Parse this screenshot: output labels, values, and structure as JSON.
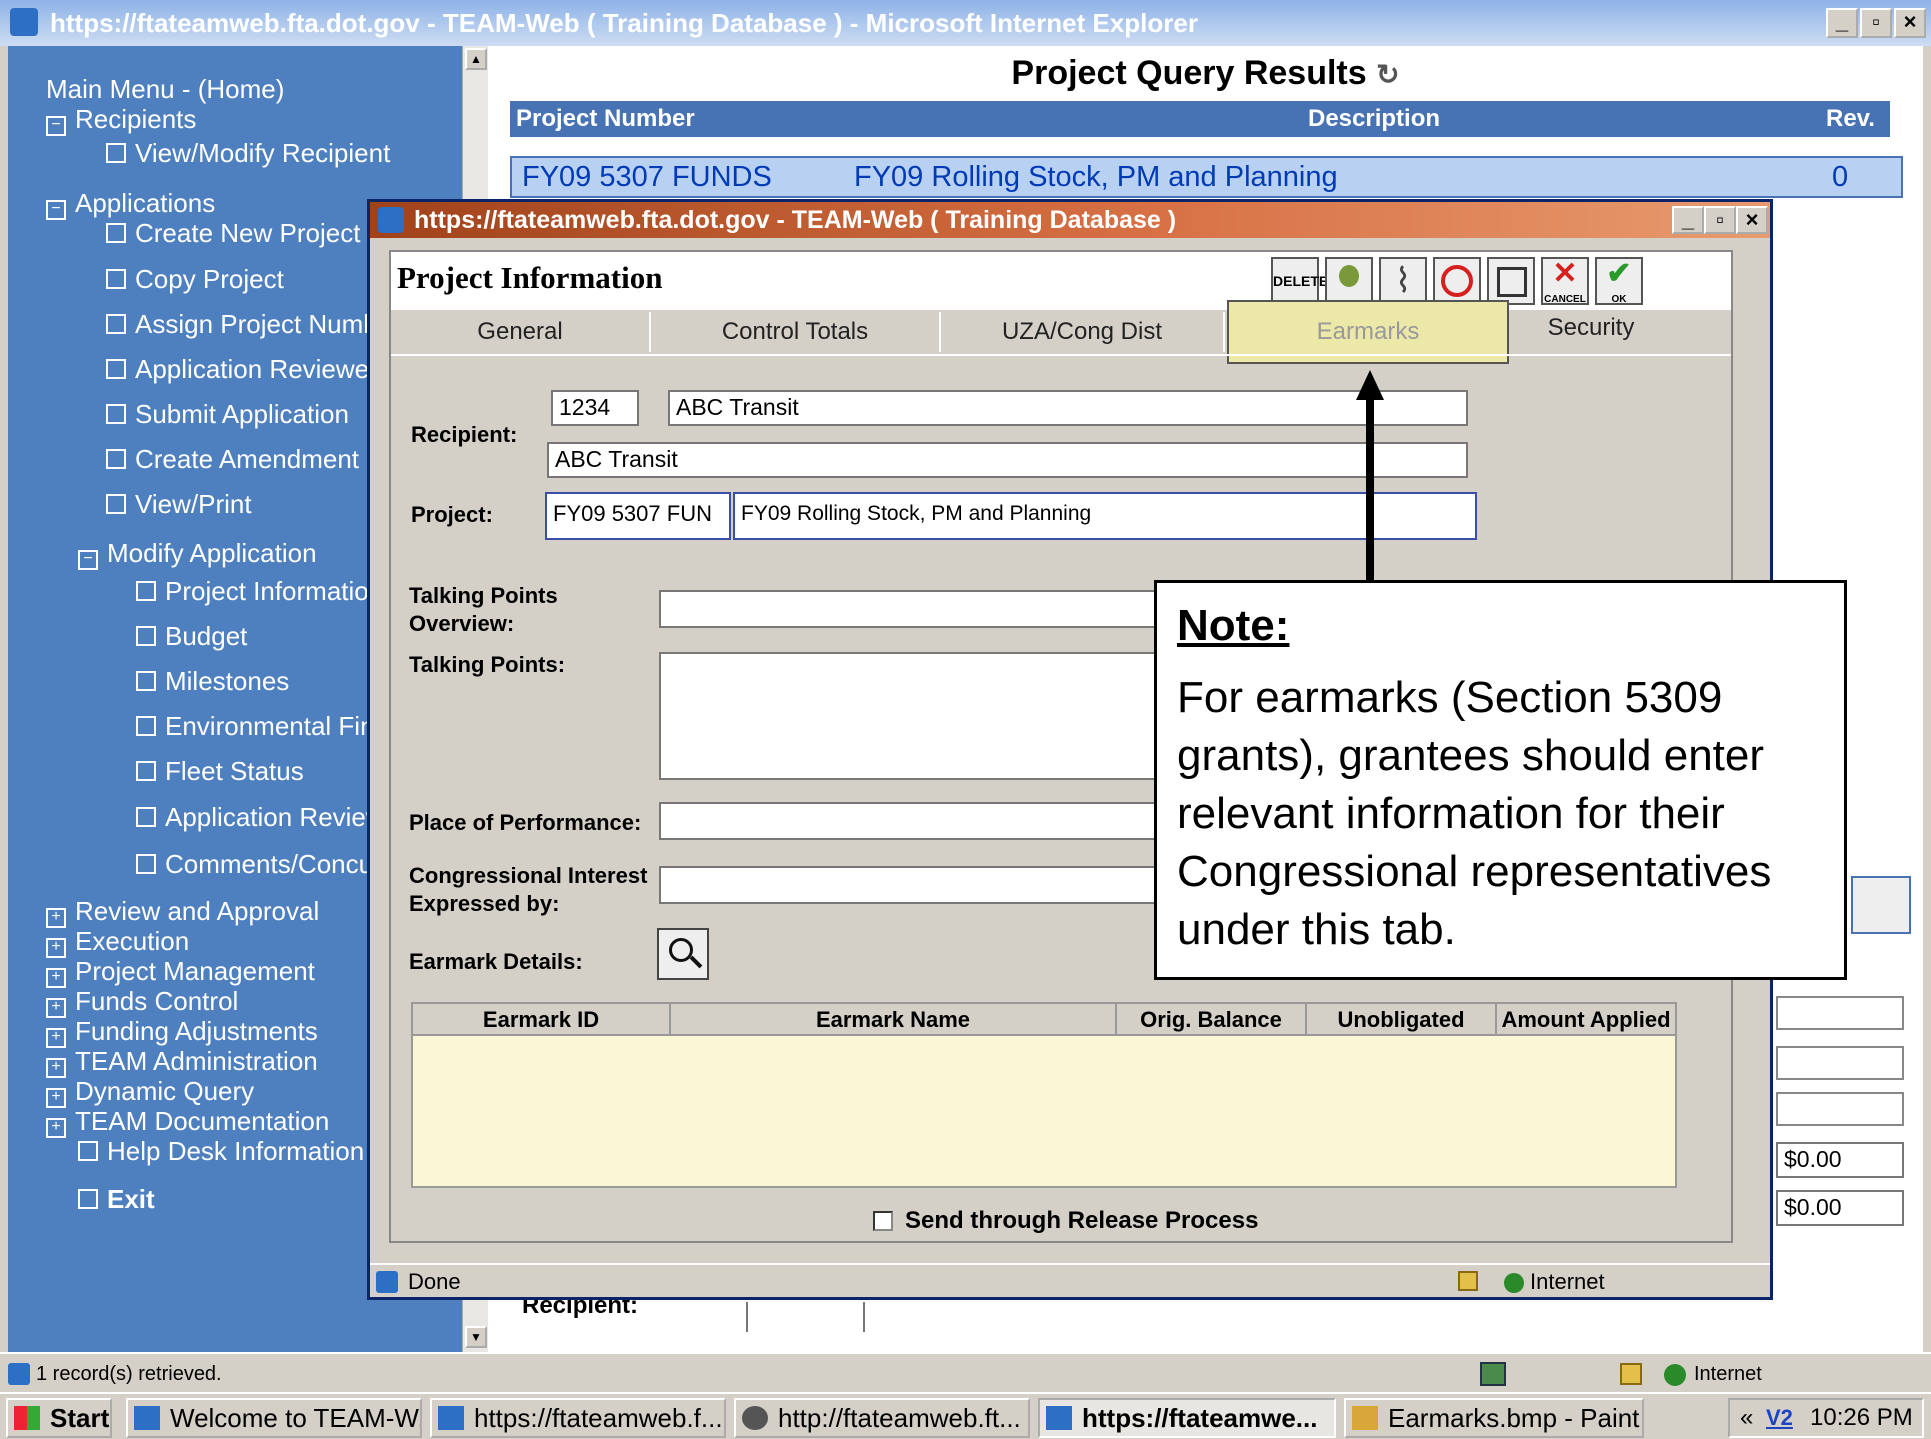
{
  "browser": {
    "title": "https://ftateamweb.fta.dot.gov - TEAM-Web ( Training Database ) - Microsoft Internet Explorer",
    "status_text": "1 record(s) retrieved.",
    "zone": "Internet"
  },
  "sidebar": {
    "items": [
      {
        "label": "Main Menu - (Home)"
      },
      {
        "label": "Recipients"
      },
      {
        "label": "View/Modify Recipient"
      },
      {
        "label": "Applications"
      },
      {
        "label": "Create New Project"
      },
      {
        "label": "Copy Project"
      },
      {
        "label": "Assign Project Numbe"
      },
      {
        "label": "Application Reviewer"
      },
      {
        "label": "Submit Application"
      },
      {
        "label": "Create Amendment"
      },
      {
        "label": "View/Print"
      },
      {
        "label": "Modify Application"
      },
      {
        "label": "Project Information"
      },
      {
        "label": "Budget"
      },
      {
        "label": "Milestones"
      },
      {
        "label": "Environmental Find"
      },
      {
        "label": "Fleet Status"
      },
      {
        "label": "Application Review"
      },
      {
        "label": "Comments/Concur"
      },
      {
        "label": "Review and Approval"
      },
      {
        "label": "Execution"
      },
      {
        "label": "Project Management"
      },
      {
        "label": "Funds Control"
      },
      {
        "label": "Funding Adjustments"
      },
      {
        "label": "TEAM Administration"
      },
      {
        "label": "Dynamic Query"
      },
      {
        "label": "TEAM Documentation"
      },
      {
        "label": "Help Desk Information"
      },
      {
        "label": "Exit"
      }
    ]
  },
  "results": {
    "title": "Project Query Results",
    "columns": [
      "Project Number",
      "Description",
      "Rev."
    ],
    "row": {
      "number": "FY09 5307 FUNDS",
      "description": "FY09 Rolling Stock, PM and Planning",
      "rev": "0"
    },
    "bg_amounts": [
      "$0.00",
      "$0.00"
    ],
    "bg_recipient_label": "Recipient:"
  },
  "popup": {
    "title": "https://ftateamweb.fta.dot.gov - TEAM-Web ( Training Database )",
    "header": "Project Information",
    "toolbar": {
      "delete": "DELETE",
      "cancel": "CANCEL",
      "ok": "OK"
    },
    "tabs": [
      "General",
      "Control Totals",
      "UZA/Cong Dist",
      "Earmarks",
      "Security"
    ],
    "form": {
      "recipient_label": "Recipient:",
      "recipient_id": "1234",
      "recipient_name": "ABC Transit",
      "recipient_name2": "ABC Transit",
      "project_label": "Project:",
      "project_number": "FY09 5307 FUN",
      "project_desc": "FY09 Rolling Stock, PM and Planning",
      "tp_overview_label_1": "Talking Points",
      "tp_overview_label_2": "Overview:",
      "tp_label": "Talking Points:",
      "place_label": "Place of Performance:",
      "congress_label_1": "Congressional Interest",
      "congress_label_2": "Expressed by:",
      "earmark_details_label": "Earmark Details:"
    },
    "grid_columns": [
      "Earmark ID",
      "Earmark Name",
      "Orig. Balance",
      "Unobligated",
      "Amount Applied"
    ],
    "release_label": "Send through Release Process",
    "status": "Done",
    "zone": "Internet"
  },
  "note": {
    "heading": "Note:",
    "body": "For earmarks (Section 5309 grants), grantees should enter relevant information for their Congressional representatives under this tab."
  },
  "taskbar": {
    "start": "Start",
    "tasks": [
      "Welcome to TEAM-W...",
      "https://ftateamweb.f...",
      "http://ftateamweb.ft...",
      "https://ftateamwe...",
      "Earmarks.bmp - Paint"
    ],
    "tray_label": "V2",
    "clock": "10:26 PM"
  },
  "colors": {
    "sidebar": "#4e7fbf",
    "header_blue": "#4773b4",
    "earmarks_tab": "#ece9a8",
    "grid_bg": "#fbf7d4"
  }
}
